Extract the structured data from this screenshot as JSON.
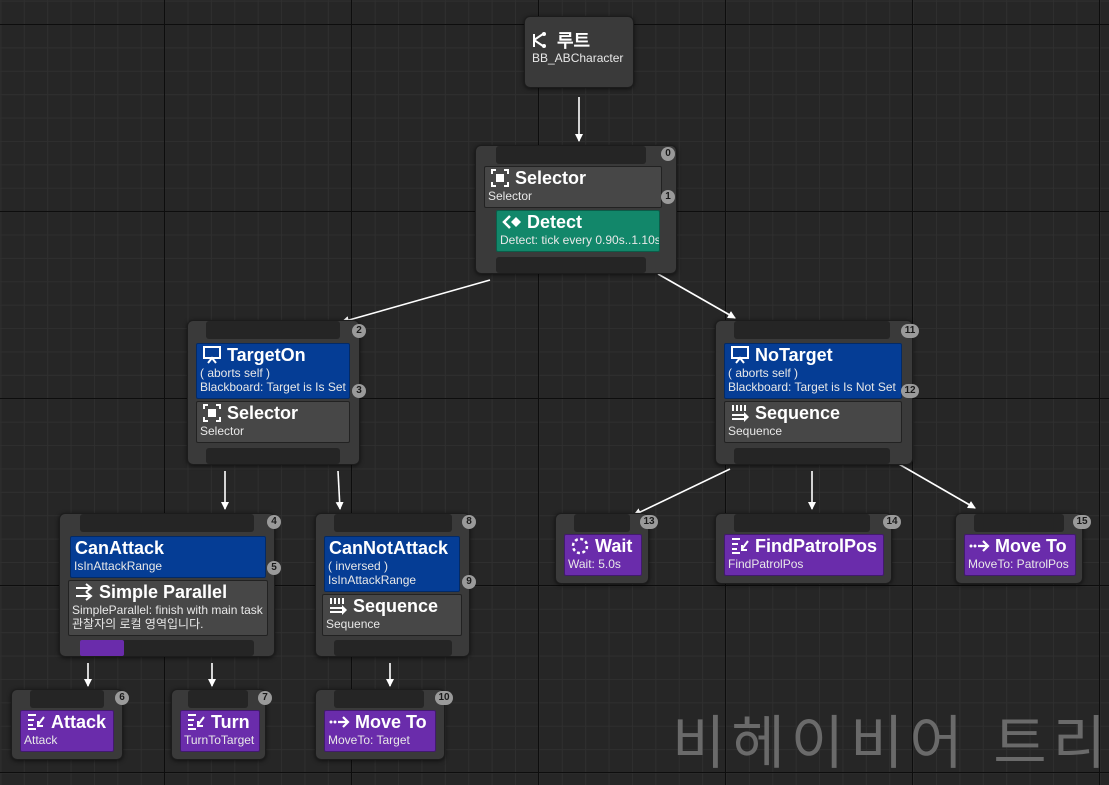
{
  "root": {
    "title": "루트",
    "subtitle": "BB_ABCharacter"
  },
  "nodes": {
    "selector_main": {
      "title": "Selector",
      "subtitle": "Selector",
      "index": "0"
    },
    "detect": {
      "title": "Detect",
      "subtitle": "Detect: tick every 0.90s..1.10s",
      "index": "1"
    },
    "target_on": {
      "title": "TargetOn",
      "line1": "( aborts self )",
      "line2": "Blackboard: Target is Is Set",
      "index": "2",
      "deco_index": "3"
    },
    "selector_target": {
      "title": "Selector",
      "subtitle": "Selector"
    },
    "no_target": {
      "title": "NoTarget",
      "line1": "( aborts self )",
      "line2": "Blackboard: Target is Is Not Set",
      "index": "11",
      "deco_index": "12"
    },
    "sequence_patrol": {
      "title": "Sequence",
      "subtitle": "Sequence"
    },
    "can_attack": {
      "title": "CanAttack",
      "subtitle": "IsInAttackRange",
      "index": "4",
      "deco_index": "5"
    },
    "simple_parallel": {
      "title": "Simple Parallel",
      "line1": "SimpleParallel: finish with main task",
      "line2": "관찰자의 로컬 영역입니다."
    },
    "can_not_attack": {
      "title": "CanNotAttack",
      "line1": "( inversed )",
      "line2": "IsInAttackRange",
      "index": "8",
      "deco_index": "9"
    },
    "sequence_chase": {
      "title": "Sequence",
      "subtitle": "Sequence"
    },
    "attack": {
      "title": "Attack",
      "subtitle": "Attack",
      "index": "6"
    },
    "turn": {
      "title": "Turn",
      "subtitle": "TurnToTarget",
      "index": "7"
    },
    "move_to_target": {
      "title": "Move To",
      "subtitle": "MoveTo: Target",
      "index": "10"
    },
    "wait": {
      "title": "Wait",
      "subtitle": "Wait: 5.0s",
      "index": "13"
    },
    "find_patrol_pos": {
      "title": "FindPatrolPos",
      "subtitle": "FindPatrolPos",
      "index": "14"
    },
    "move_to_patrol": {
      "title": "Move To",
      "subtitle": "MoveTo: PatrolPos",
      "index": "15"
    }
  },
  "watermark": "비헤이비어 트리",
  "colors": {
    "composite": "#474747",
    "service": "#12876a",
    "decorator": "#053d95",
    "task": "#6a2cab",
    "background": "#262626"
  },
  "icons": {
    "root": "tree-branch-icon",
    "selector": "selector-icon",
    "service": "service-icon",
    "decorator": "blackboard-icon",
    "sequence": "sequence-icon",
    "parallel": "parallel-icon",
    "task": "task-icon",
    "wait": "wait-icon",
    "move": "move-to-icon"
  }
}
